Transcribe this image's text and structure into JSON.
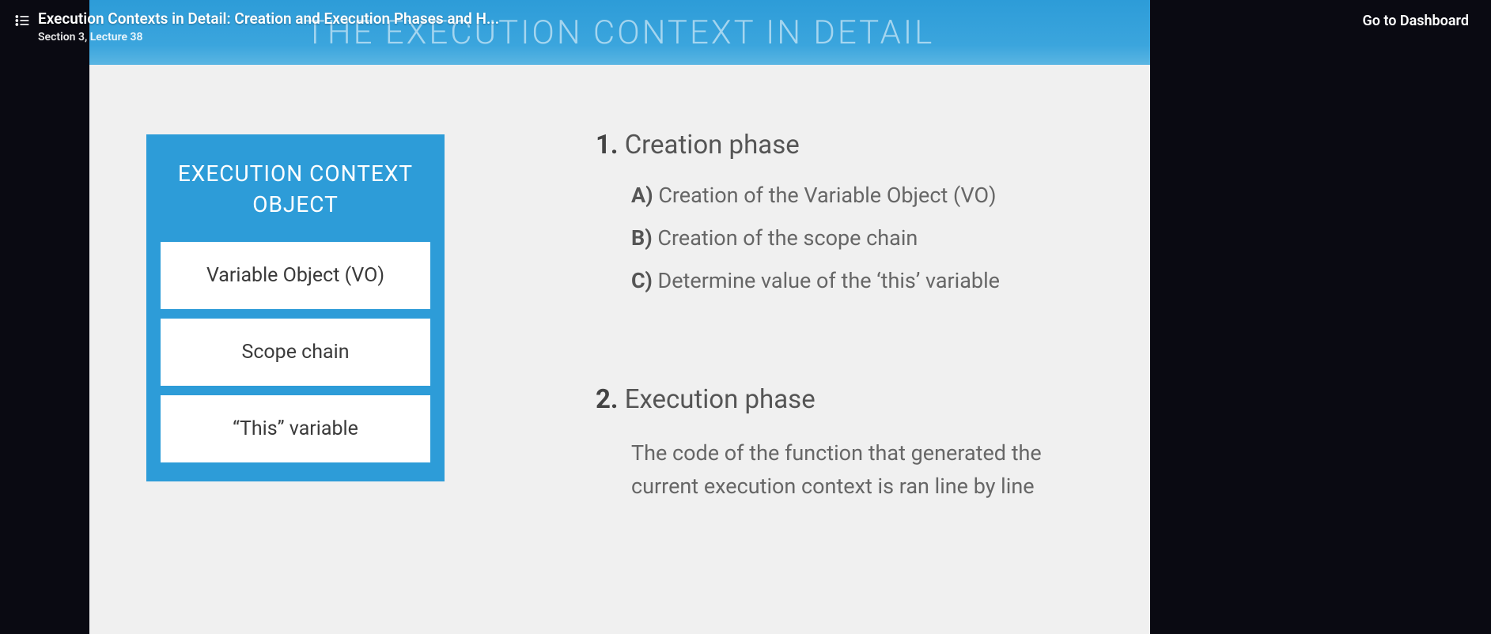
{
  "player": {
    "lecture_title": "Execution Contexts in Detail: Creation and Execution Phases and H...",
    "lecture_meta": "Section 3, Lecture 38",
    "dashboard_link": "Go to Dashboard"
  },
  "slide": {
    "banner_title": "THE EXECUTION CONTEXT IN DETAIL",
    "ec_box": {
      "title": "EXECUTION CONTEXT OBJECT",
      "items": [
        "Variable Object (VO)",
        "Scope chain",
        "“This” variable"
      ]
    },
    "phase1": {
      "num": "1.",
      "title": "Creation phase",
      "subs": [
        {
          "letter": "A)",
          "text": "Creation of the Variable Object (VO)"
        },
        {
          "letter": "B)",
          "text": "Creation of the scope chain"
        },
        {
          "letter": "C)",
          "text": "Determine value of the ‘this’ variable"
        }
      ]
    },
    "phase2": {
      "num": "2.",
      "title": "Execution phase",
      "desc": "The code of the function that generated the current execution context is ran line by line"
    }
  }
}
